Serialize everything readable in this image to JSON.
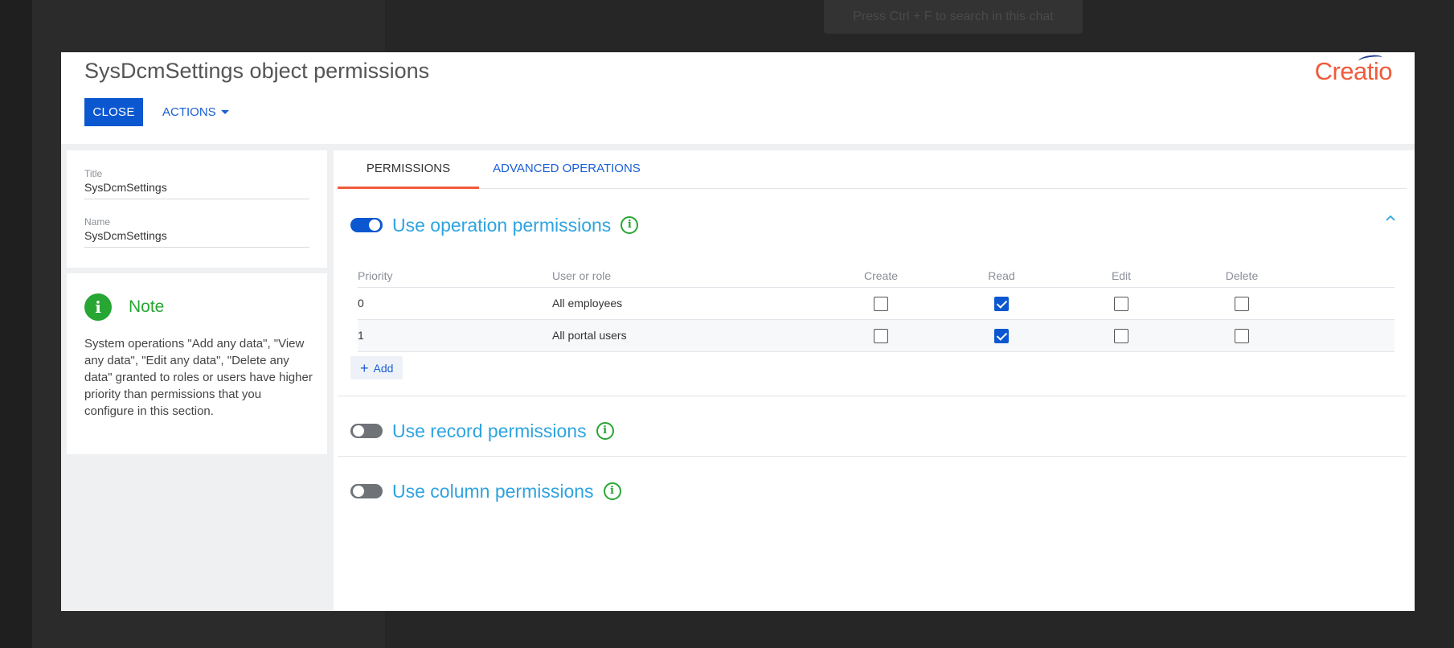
{
  "background": {
    "search_hint": "Press Ctrl + F to search in this chat"
  },
  "header": {
    "title": "SysDcmSettings object permissions",
    "close_label": "CLOSE",
    "actions_label": "ACTIONS",
    "logo_text": "Creatio"
  },
  "fields": {
    "title_label": "Title",
    "title_value": "SysDcmSettings",
    "name_label": "Name",
    "name_value": "SysDcmSettings"
  },
  "note": {
    "icon": "info-icon",
    "title": "Note",
    "text": "System operations \"Add any data\", \"View any data\", \"Edit any data\", \"Delete any data\" granted to roles or users have higher priority than permissions that you configure in this section."
  },
  "tabs": [
    {
      "label": "PERMISSIONS",
      "active": true
    },
    {
      "label": "ADVANCED OPERATIONS",
      "active": false
    }
  ],
  "operation_section": {
    "title": "Use operation permissions",
    "enabled": true,
    "columns": {
      "priority": "Priority",
      "user": "User or role",
      "create": "Create",
      "read": "Read",
      "edit": "Edit",
      "delete": "Delete"
    },
    "rows": [
      {
        "priority": "0",
        "user": "All employees",
        "create": false,
        "read": true,
        "edit": false,
        "delete": false
      },
      {
        "priority": "1",
        "user": "All portal users",
        "create": false,
        "read": true,
        "edit": false,
        "delete": false
      }
    ],
    "add_label": "Add"
  },
  "record_section": {
    "title": "Use record permissions",
    "enabled": false
  },
  "column_section": {
    "title": "Use column permissions",
    "enabled": false
  },
  "colors": {
    "accent": "#0b57d0",
    "link": "#1a5fd6",
    "section_title": "#2ea3e0",
    "info_green": "#27a633",
    "logo": "#f05a3a"
  }
}
